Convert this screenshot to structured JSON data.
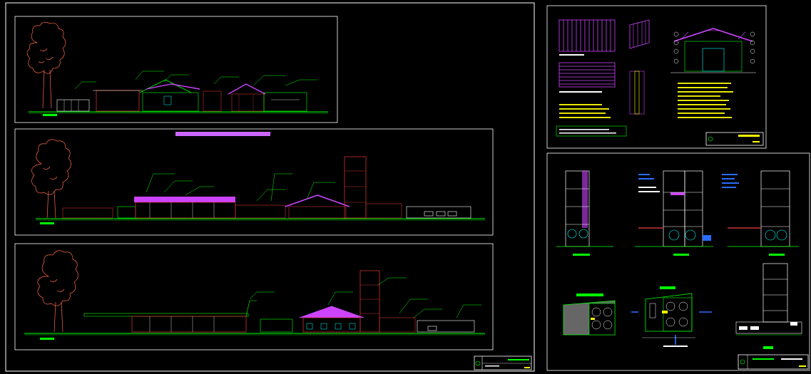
{
  "drawing": {
    "colors": {
      "background": "#000000",
      "frame": "#ffffff",
      "ground": "#00ff00",
      "tree": "#ff6a4a",
      "roof": "#cc44ff",
      "wall": "#cc3333",
      "annotation": "#00ff00",
      "glazing": "#00ffff",
      "structure": "#ffff00",
      "callout": "#2a6cff",
      "banner": "#cc66ff"
    },
    "sheet_left": {
      "elevations": [
        {
          "id": "elevation-top",
          "has_tower": false
        },
        {
          "id": "elevation-middle",
          "has_tower": true
        },
        {
          "id": "elevation-bottom",
          "has_tower": true
        }
      ],
      "title_block": {
        "icon": "compass-icon"
      }
    },
    "sheet_top_right": {
      "panels": [
        "wood-panel-vertical",
        "wood-panel-horizontal",
        "gate-detail",
        "truss-section"
      ],
      "title_block": {
        "icon": "compass-icon"
      }
    },
    "sheet_bottom_right": {
      "sections": [
        "section-left",
        "section-center",
        "section-right"
      ],
      "plans": [
        "plan-left",
        "plan-center",
        "tower-elevation"
      ],
      "title_block": {
        "icon": "compass-icon"
      }
    }
  }
}
